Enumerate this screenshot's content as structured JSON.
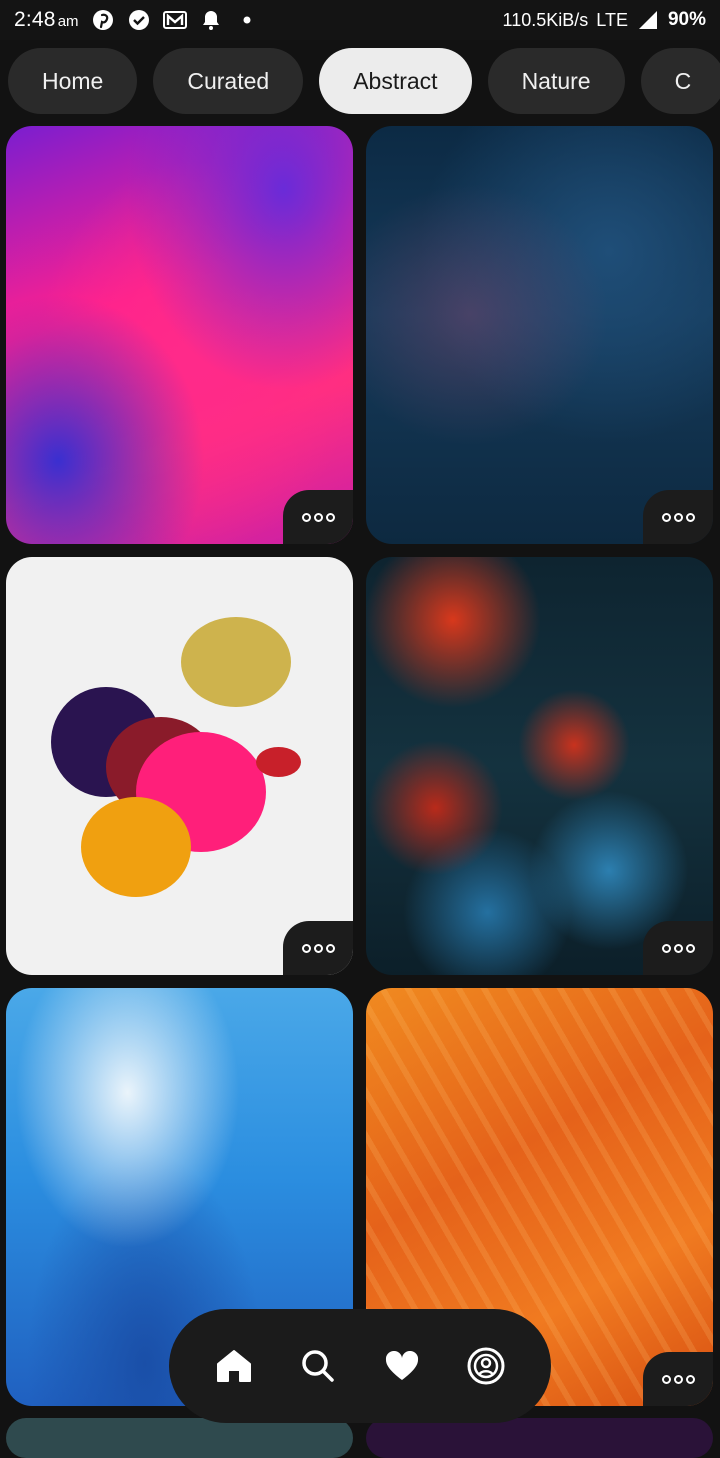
{
  "status_bar": {
    "time": "2:48",
    "ampm": "am",
    "notification_icons": [
      "pinterest-icon",
      "check-circle-icon",
      "gmail-icon",
      "bell-icon",
      "dot-icon"
    ],
    "network_speed": "110.5KiB/s",
    "network_type": "LTE",
    "battery": "90%"
  },
  "categories": {
    "items": [
      "Home",
      "Curated",
      "Abstract",
      "Nature",
      "C"
    ],
    "selected": "Abstract"
  },
  "wallpapers": [
    {
      "description": "pink and blue paint swirl",
      "menu_icon": "more-icon"
    },
    {
      "description": "dark blue galaxy texture",
      "menu_icon": "more-icon"
    },
    {
      "description": "paint splash on white",
      "menu_icon": "more-icon"
    },
    {
      "description": "red and blue succulents",
      "menu_icon": "more-icon"
    },
    {
      "description": "blue pixel texture",
      "menu_icon": "more-icon"
    },
    {
      "description": "orange brush strokes",
      "menu_icon": "more-icon"
    }
  ],
  "bottom_nav": {
    "items": [
      "home-icon",
      "search-icon",
      "heart-icon",
      "profile-icon"
    ]
  },
  "colors": {
    "background": "#121212",
    "chip": "#2a2a2a",
    "chip_active": "#ececec",
    "nav": "#1b1b1b"
  }
}
